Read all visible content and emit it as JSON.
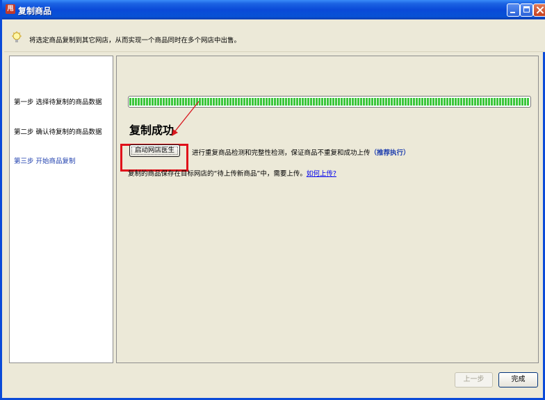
{
  "window": {
    "title": "复制商品",
    "app_icon_text": "甩",
    "icons": [
      "app-icon",
      "minimize-icon",
      "maximize-icon",
      "close-icon"
    ]
  },
  "tip": {
    "icon": "lightbulb-icon",
    "text": "将选定商品复制到其它网店，从而实现一个商品同时在多个网店中出售。"
  },
  "steps": [
    {
      "label": "第一步  选择待复制的商品数据"
    },
    {
      "label": "第二步  确认待复制的商品数据"
    },
    {
      "label": "第三步  开始商品复制",
      "active": true
    }
  ],
  "main": {
    "progress": 1.0,
    "success_title": "复制成功",
    "launch_button": "启动网店医生",
    "check_desc": "进行重复商品检测和完整性检测，保证商品不重复和成功上传",
    "recommend_link": "（推荐执行）",
    "saved_desc": "复制的商品保存在目标网店的“待上传新商品”中，需要上传。",
    "howto_link": "如何上传?"
  },
  "footer": {
    "prev_label": "上一步",
    "finish_label": "完成"
  },
  "colors": {
    "titlebar": "#0a4ad8",
    "highlight": "#e0101a",
    "progress": "#3bc63b",
    "active_step": "#1f3fae"
  }
}
